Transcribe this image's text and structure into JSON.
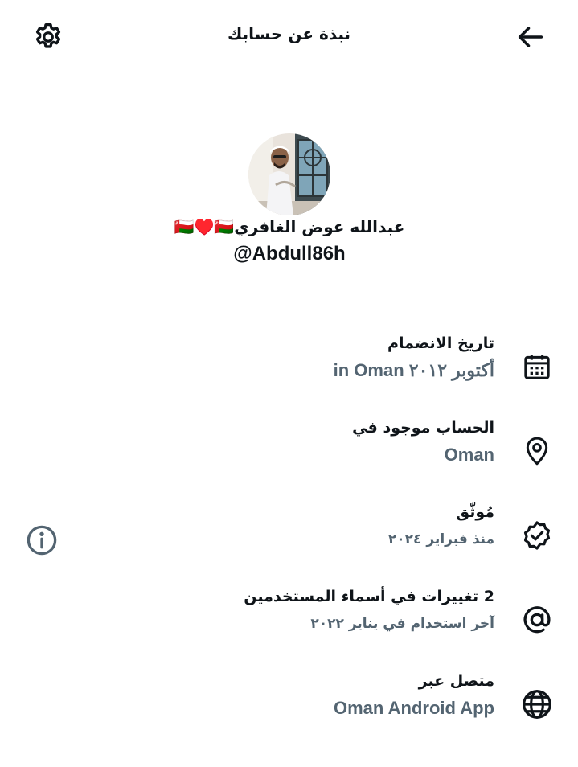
{
  "header": {
    "title": "نبذة عن حسابك"
  },
  "profile": {
    "display_name": "عبدالله عوض الغافري🇴🇲♥️🇴🇲",
    "username": "@Abdull86h"
  },
  "details": {
    "joined": {
      "label": "تاريخ الانضمام",
      "value": "أكتوبر ٢٠١٢ in Oman",
      "icon": "calendar-icon"
    },
    "location": {
      "label": "الحساب موجود في",
      "value": "Oman",
      "icon": "location-pin-icon"
    },
    "verified": {
      "label": "مُوثّق",
      "value": "منذ فبراير ٢٠٢٤",
      "icon": "verified-badge-icon"
    },
    "username_changes": {
      "label": "2 تغييرات في أسماء المستخدمين",
      "value": "آخر استخدام في يناير ٢٠٢٢",
      "icon": "at-sign-icon"
    },
    "connected_via": {
      "label": "متصل عبر",
      "value": "Oman Android App",
      "icon": "globe-icon"
    }
  },
  "colors": {
    "text_primary": "#0f1419",
    "text_secondary": "#536471"
  }
}
